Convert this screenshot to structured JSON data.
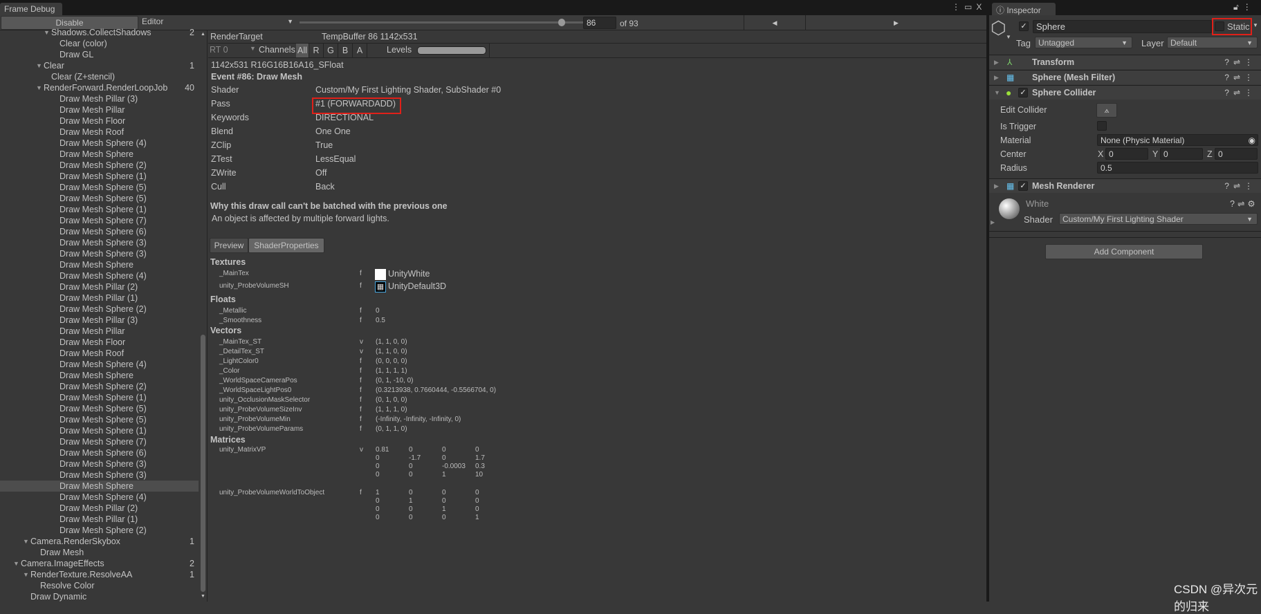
{
  "frame_debug": {
    "tab_title": "Frame Debug",
    "disable_label": "Disable",
    "target_dropdown": "Editor",
    "event_index": "86",
    "event_total_label": "of 93",
    "slider_fraction": 0.925,
    "prev_icon": "triangle-left-icon",
    "next_icon": "triangle-right-icon",
    "tree": [
      {
        "label": "Shadows.CollectShadows",
        "count": "2",
        "depth": 4,
        "expanded": true
      },
      {
        "label": "Clear (color)",
        "depth": 5
      },
      {
        "label": "Draw GL",
        "depth": 5
      },
      {
        "label": "Clear",
        "count": "1",
        "depth": 3,
        "expanded": true
      },
      {
        "label": "Clear (Z+stencil)",
        "depth": 4
      },
      {
        "label": "RenderForward.RenderLoopJob",
        "count": "40",
        "depth": 3,
        "expanded": true
      },
      {
        "label": "Draw Mesh Pillar (3)",
        "depth": 5
      },
      {
        "label": "Draw Mesh Pillar",
        "depth": 5
      },
      {
        "label": "Draw Mesh Floor",
        "depth": 5
      },
      {
        "label": "Draw Mesh Roof",
        "depth": 5
      },
      {
        "label": "Draw Mesh Sphere (4)",
        "depth": 5
      },
      {
        "label": "Draw Mesh Sphere",
        "depth": 5
      },
      {
        "label": "Draw Mesh Sphere (2)",
        "depth": 5
      },
      {
        "label": "Draw Mesh Sphere (1)",
        "depth": 5
      },
      {
        "label": "Draw Mesh Sphere (5)",
        "depth": 5
      },
      {
        "label": "Draw Mesh Sphere (5)",
        "depth": 5
      },
      {
        "label": "Draw Mesh Sphere (1)",
        "depth": 5
      },
      {
        "label": "Draw Mesh Sphere (7)",
        "depth": 5
      },
      {
        "label": "Draw Mesh Sphere (6)",
        "depth": 5
      },
      {
        "label": "Draw Mesh Sphere (3)",
        "depth": 5
      },
      {
        "label": "Draw Mesh Sphere (3)",
        "depth": 5
      },
      {
        "label": "Draw Mesh Sphere",
        "depth": 5
      },
      {
        "label": "Draw Mesh Sphere (4)",
        "depth": 5
      },
      {
        "label": "Draw Mesh Pillar (2)",
        "depth": 5
      },
      {
        "label": "Draw Mesh Pillar (1)",
        "depth": 5
      },
      {
        "label": "Draw Mesh Sphere (2)",
        "depth": 5
      },
      {
        "label": "Draw Mesh Pillar (3)",
        "depth": 5
      },
      {
        "label": "Draw Mesh Pillar",
        "depth": 5
      },
      {
        "label": "Draw Mesh Floor",
        "depth": 5
      },
      {
        "label": "Draw Mesh Roof",
        "depth": 5
      },
      {
        "label": "Draw Mesh Sphere (4)",
        "depth": 5
      },
      {
        "label": "Draw Mesh Sphere",
        "depth": 5
      },
      {
        "label": "Draw Mesh Sphere (2)",
        "depth": 5
      },
      {
        "label": "Draw Mesh Sphere (1)",
        "depth": 5
      },
      {
        "label": "Draw Mesh Sphere (5)",
        "depth": 5
      },
      {
        "label": "Draw Mesh Sphere (5)",
        "depth": 5
      },
      {
        "label": "Draw Mesh Sphere (1)",
        "depth": 5
      },
      {
        "label": "Draw Mesh Sphere (7)",
        "depth": 5
      },
      {
        "label": "Draw Mesh Sphere (6)",
        "depth": 5
      },
      {
        "label": "Draw Mesh Sphere (3)",
        "depth": 5
      },
      {
        "label": "Draw Mesh Sphere (3)",
        "depth": 5
      },
      {
        "label": "Draw Mesh Sphere",
        "depth": 5,
        "selected": true
      },
      {
        "label": "Draw Mesh Sphere (4)",
        "depth": 5
      },
      {
        "label": "Draw Mesh Pillar (2)",
        "depth": 5
      },
      {
        "label": "Draw Mesh Pillar (1)",
        "depth": 5
      },
      {
        "label": "Draw Mesh Sphere (2)",
        "depth": 5
      },
      {
        "label": "Camera.RenderSkybox",
        "count": "1",
        "depth": 1,
        "expanded": true
      },
      {
        "label": "Draw Mesh",
        "depth": 2
      },
      {
        "label": "Camera.ImageEffects",
        "count": "2",
        "depth": 0,
        "expanded": true
      },
      {
        "label": "RenderTexture.ResolveAA",
        "count": "1",
        "depth": 1,
        "expanded": true
      },
      {
        "label": "Resolve Color",
        "depth": 2
      },
      {
        "label": "Draw Dynamic",
        "depth": 1
      }
    ],
    "detail": {
      "render_target_label": "RenderTarget",
      "render_target_value": "TempBuffer 86 1142x531",
      "rt_dropdown": "RT 0",
      "channels_label": "Channels",
      "channels": [
        "All",
        "R",
        "G",
        "B",
        "A"
      ],
      "levels_label": "Levels",
      "format": "1142x531 R16G16B16A16_SFloat",
      "event_title": "Event #86: Draw Mesh",
      "props": [
        {
          "k": "Shader",
          "v": "Custom/My First Lighting Shader, SubShader #0"
        },
        {
          "k": "Pass",
          "v": "#1 (FORWARDADD)"
        },
        {
          "k": "Keywords",
          "v": "DIRECTIONAL"
        },
        {
          "k": "Blend",
          "v": "One One"
        },
        {
          "k": "ZClip",
          "v": "True"
        },
        {
          "k": "ZTest",
          "v": "LessEqual"
        },
        {
          "k": "ZWrite",
          "v": "Off"
        },
        {
          "k": "Cull",
          "v": "Back"
        }
      ],
      "batch_title": "Why this draw call can't be batched with the previous one",
      "batch_reason": "An object is affected by multiple forward lights.",
      "tabs": [
        "Preview",
        "ShaderProperties"
      ],
      "textures_heading": "Textures",
      "textures": [
        {
          "name": "_MainTex",
          "type": "f",
          "value": "UnityWhite"
        },
        {
          "name": "unity_ProbeVolumeSH",
          "type": "f",
          "value": "UnityDefault3D"
        }
      ],
      "floats_heading": "Floats",
      "floats": [
        {
          "name": "_Metallic",
          "type": "f",
          "value": "0"
        },
        {
          "name": "_Smoothness",
          "type": "f",
          "value": "0.5"
        }
      ],
      "vectors_heading": "Vectors",
      "vectors": [
        {
          "name": "_MainTex_ST",
          "type": "v",
          "value": "(1, 1, 0, 0)"
        },
        {
          "name": "_DetailTex_ST",
          "type": "v",
          "value": "(1, 1, 0, 0)"
        },
        {
          "name": "_LightColor0",
          "type": "f",
          "value": "(0, 0, 0, 0)"
        },
        {
          "name": "_Color",
          "type": "f",
          "value": "(1, 1, 1, 1)"
        },
        {
          "name": "_WorldSpaceCameraPos",
          "type": "f",
          "value": "(0, 1, -10, 0)"
        },
        {
          "name": "_WorldSpaceLightPos0",
          "type": "f",
          "value": "(0.3213938, 0.7660444, -0.5566704, 0)"
        },
        {
          "name": "unity_OcclusionMaskSelector",
          "type": "f",
          "value": "(0, 1, 0, 0)"
        },
        {
          "name": "unity_ProbeVolumeSizeInv",
          "type": "f",
          "value": "(1, 1, 1, 0)"
        },
        {
          "name": "unity_ProbeVolumeMin",
          "type": "f",
          "value": "(-Infinity, -Infinity, -Infinity, 0)"
        },
        {
          "name": "unity_ProbeVolumeParams",
          "type": "f",
          "value": "(0, 1, 1, 0)"
        }
      ],
      "matrices_heading": "Matrices",
      "matrices": [
        {
          "name": "unity_MatrixVP",
          "type": "v",
          "rows": [
            [
              "0.81",
              "0",
              "0",
              "0"
            ],
            [
              "0",
              "-1.7",
              "0",
              "1.7"
            ],
            [
              "0",
              "0",
              "-0.0003",
              "0.3"
            ],
            [
              "0",
              "0",
              "1",
              "10"
            ]
          ]
        },
        {
          "name": "unity_ProbeVolumeWorldToObject",
          "type": "f",
          "rows": [
            [
              "1",
              "0",
              "0",
              "0"
            ],
            [
              "0",
              "1",
              "0",
              "0"
            ],
            [
              "0",
              "0",
              "1",
              "0"
            ],
            [
              "0",
              "0",
              "0",
              "1"
            ]
          ]
        }
      ]
    }
  },
  "inspector": {
    "tab_title": "Inspector",
    "object_name": "Sphere",
    "active": true,
    "static_label": "Static",
    "static": false,
    "tag_label": "Tag",
    "tag_value": "Untagged",
    "layer_label": "Layer",
    "layer_value": "Default",
    "components": {
      "transform": "Transform",
      "mesh_filter": "Sphere (Mesh Filter)",
      "sphere_collider": "Sphere Collider",
      "mesh_renderer": "Mesh Renderer"
    },
    "collider": {
      "edit_collider_label": "Edit Collider",
      "is_trigger_label": "Is Trigger",
      "material_label": "Material",
      "material_value": "None (Physic Material)",
      "center_label": "Center",
      "center": {
        "x": "0",
        "y": "0",
        "z": "0"
      },
      "radius_label": "Radius",
      "radius_value": "0.5"
    },
    "material": {
      "name": "White",
      "shader_label": "Shader",
      "shader_value": "Custom/My First Lighting Shader"
    },
    "add_component_label": "Add Component"
  },
  "watermark": "CSDN @异次元的归来",
  "colors": {
    "highlight_box": "#e02019",
    "background": "#383838",
    "selected_row": "#4d4d4d"
  }
}
